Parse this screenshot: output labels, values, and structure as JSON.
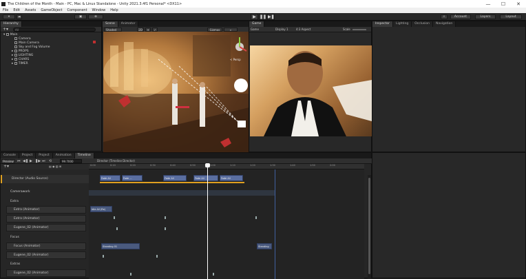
{
  "window": {
    "title": "The Children of the Month - Main - PC, Mac & Linux Standalone - Unity 2021.3.4f1 Personal* <DX11>",
    "minimize": "—",
    "maximize": "☐",
    "close": "✕"
  },
  "menu": [
    "File",
    "Edit",
    "Assets",
    "GameObject",
    "Component",
    "Window",
    "Help"
  ],
  "toolbar": {
    "account_btn": "Account",
    "layers_btn": "Layers",
    "layout_btn": "Layout"
  },
  "hierarchy": {
    "tab": "Hierarchy",
    "search_placeholder": "All",
    "scene": "Main",
    "items": [
      "Camera",
      "Main Camera",
      "Sky and Fog Volume",
      "PROPS",
      "LIGHTING",
      "CHARS",
      "TIMER"
    ]
  },
  "scene": {
    "tabs": [
      "Scene",
      "Animator"
    ],
    "shading": "Shaded",
    "mode": "2D",
    "gizmos": "Gizmos",
    "persp_label": "< Persp"
  },
  "game": {
    "tab": "Game",
    "display": "Game",
    "display_num": "Display 1",
    "aspect": "4:3 Aspect",
    "scale_label": "Scale"
  },
  "inspector": {
    "tabs": [
      "Inspector",
      "Lighting",
      "Occlusion",
      "Navigation"
    ]
  },
  "bottom_tabs": [
    "Console",
    "Project",
    "Project",
    "Animation",
    "Timeline"
  ],
  "timeline": {
    "preview_btn": "Preview",
    "frame": "99.7000",
    "director_label": "Director (Timeline Director)",
    "ruler_labels": [
      "0:00",
      "0:10",
      "0:20",
      "0:30",
      "0:40",
      "0:50",
      "1:00",
      "1:10",
      "1:20",
      "1:30",
      "1:40",
      "1:50",
      "2:00"
    ],
    "tracks": {
      "director_audio": "Director (Audio Source)",
      "groups": [
        "Camerawork",
        "Extra",
        "Focus",
        "Extras"
      ],
      "rows": [
        "Extra (Animator)",
        "Extra (Animator)",
        "Eugene_02 (Animator)",
        "Focus (Animator)",
        "Eugene_02 (Animator)",
        "Eugene_02 (Animator)"
      ]
    },
    "clip_labels": {
      "c1": "Fade All",
      "c2": "Fade ...",
      "c3": "Fade All",
      "c4": "Fade All",
      "c5": "Fade All",
      "extra_clip": "Idle All (Re)",
      "focus_clip": "Standing 01",
      "focus_clip2": "Standing"
    }
  }
}
